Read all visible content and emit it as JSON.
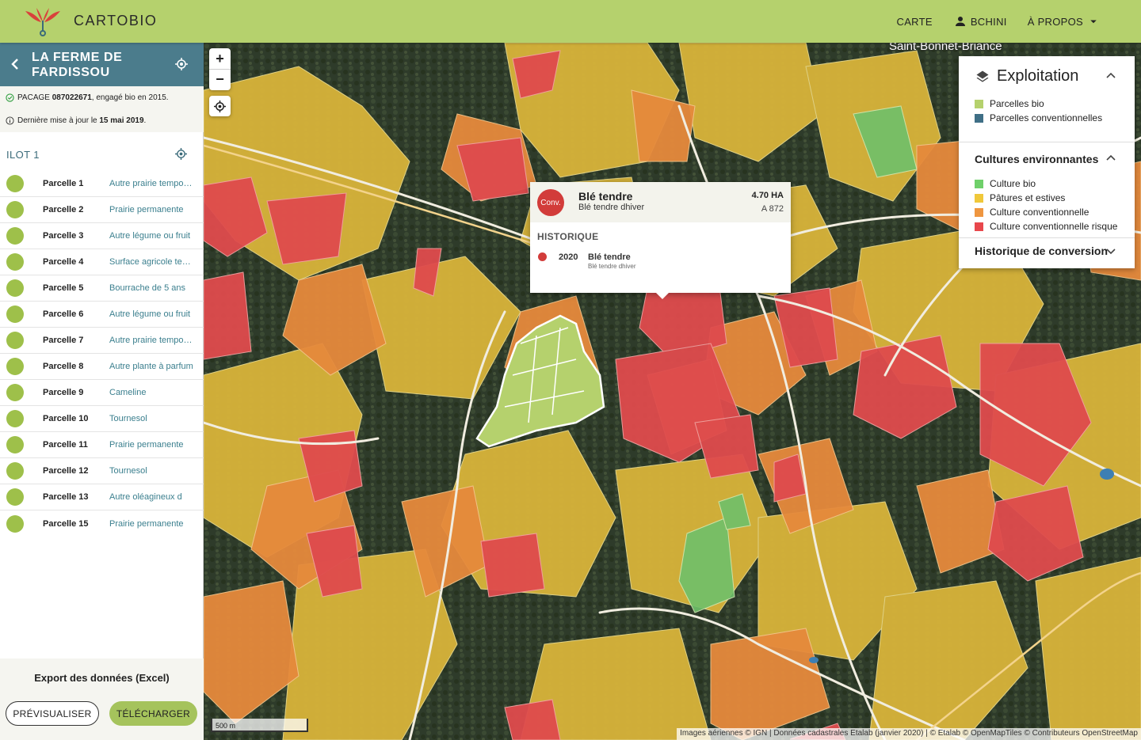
{
  "app": {
    "name": "CARTOBIO"
  },
  "nav": {
    "carte": "CARTE",
    "user": "BCHINI",
    "about": "À PROPOS"
  },
  "farm": {
    "name": "LA FERME DE FARDISSOU",
    "pacage_prefix": "PACAGE ",
    "pacage": "087022671",
    "engaged": ", engagé bio en 2015.",
    "update_prefix": "Dernière mise à jour le ",
    "update_date": "15 mai 2019",
    "update_suffix": "."
  },
  "ilot": {
    "title": "ILOT 1"
  },
  "parcels": [
    {
      "name": "Parcelle 1",
      "crop": "Autre prairie temporaire"
    },
    {
      "name": "Parcelle 2",
      "crop": "Prairie permanente"
    },
    {
      "name": "Parcelle 3",
      "crop": "Autre légume ou fruit"
    },
    {
      "name": "Parcelle 4",
      "crop": "Surface agricole temporaire"
    },
    {
      "name": "Parcelle 5",
      "crop": "Bourrache de 5 ans"
    },
    {
      "name": "Parcelle 6",
      "crop": "Autre légume ou fruit"
    },
    {
      "name": "Parcelle 7",
      "crop": "Autre prairie temporaire"
    },
    {
      "name": "Parcelle 8",
      "crop": "Autre plante à parfum"
    },
    {
      "name": "Parcelle 9",
      "crop": "Cameline"
    },
    {
      "name": "Parcelle 10",
      "crop": "Tournesol"
    },
    {
      "name": "Parcelle 11",
      "crop": "Prairie permanente"
    },
    {
      "name": "Parcelle 12",
      "crop": "Tournesol"
    },
    {
      "name": "Parcelle 13",
      "crop": "Autre oléagineux d"
    },
    {
      "name": "Parcelle 15",
      "crop": "Prairie permanente"
    }
  ],
  "export": {
    "title": "Export des données (Excel)",
    "preview": "PRÉVISUALISER",
    "download": "TÉLÉCHARGER"
  },
  "map": {
    "town": "Saint-Bonnet-Briance",
    "scale": "500 m",
    "attribution": "Images aériennes © IGN | Données cadastrales Etalab (janvier 2020) | © Etalab © OpenMapTiles © Contributeurs OpenStreetMap",
    "zoom_in": "+",
    "zoom_out": "−"
  },
  "popup": {
    "badge": "Conv.",
    "title": "Blé tendre",
    "subtitle": "Blé tendre dhiver",
    "area": "4.70 HA",
    "ref": "A 872",
    "history_title": "HISTORIQUE",
    "history": [
      {
        "year": "2020",
        "crop": "Blé tendre",
        "detail": "Blé tendre dhiver"
      }
    ]
  },
  "legend": {
    "title": "Exploitation",
    "exploitation": [
      {
        "label": "Parcelles bio",
        "color": "#b5d16d"
      },
      {
        "label": "Parcelles conventionnelles",
        "color": "#3f6f86"
      }
    ],
    "surroundings_title": "Cultures environnantes",
    "surroundings": [
      {
        "label": "Culture bio",
        "color": "#6fd06a"
      },
      {
        "label": "Pâtures et estives",
        "color": "#f0c83a"
      },
      {
        "label": "Culture conventionnelle",
        "color": "#ef9640"
      },
      {
        "label": "Culture conventionnelle risque",
        "color": "#e8474c"
      }
    ],
    "history_title": "Historique de conversion"
  },
  "colors": {
    "topbar": "#b5d16d",
    "farm_header": "#4b7c8c",
    "accent_link": "#3b7f8e",
    "conv_red": "#d23c3a"
  }
}
